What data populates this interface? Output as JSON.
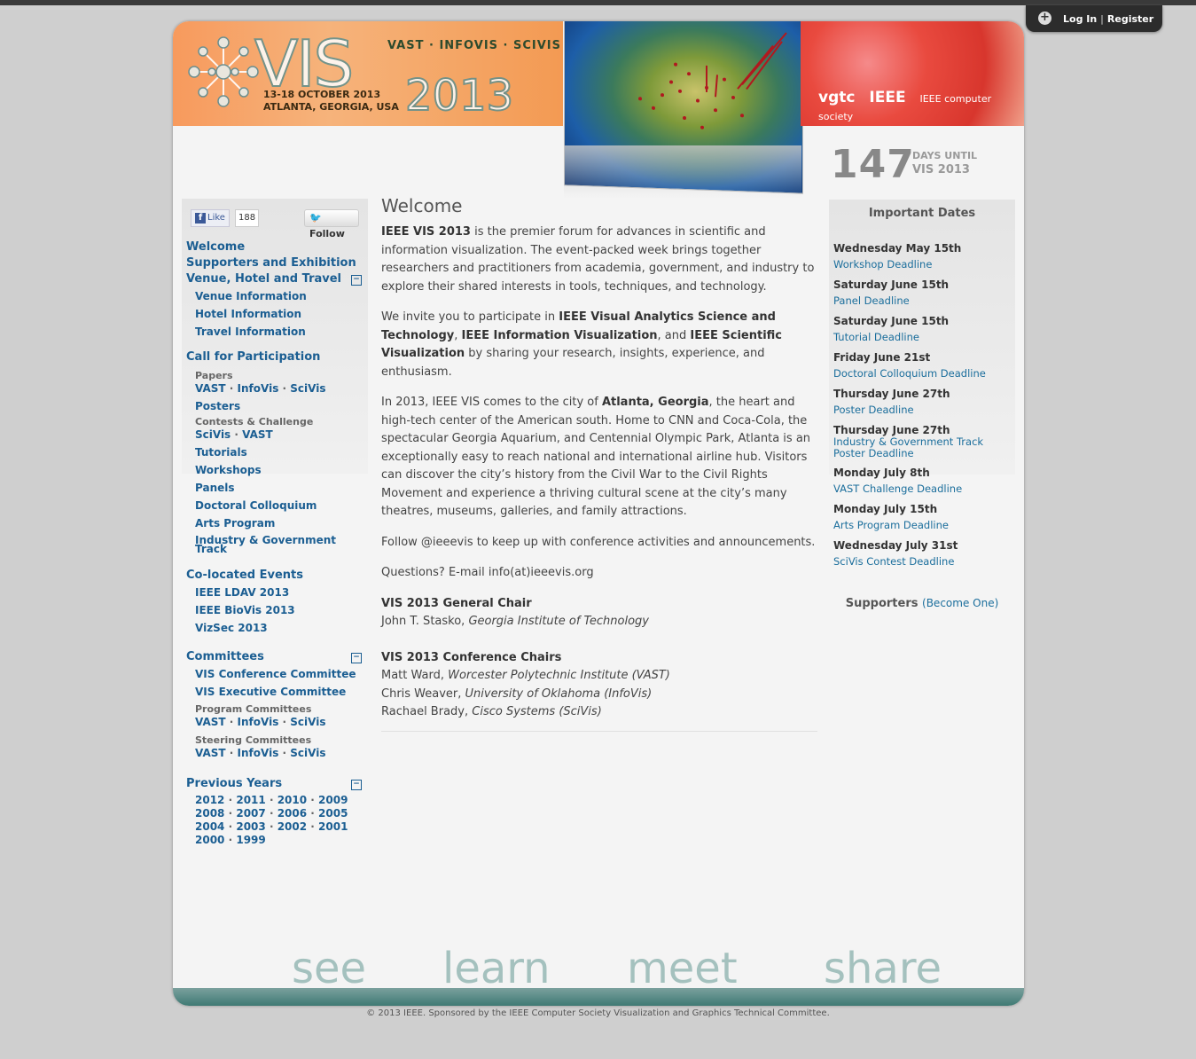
{
  "login": {
    "login_label": "Log In",
    "sep": "|",
    "register_label": "Register"
  },
  "header": {
    "logo_text": "VIS",
    "logo_year": "2013",
    "tracks": "VAST · INFOVIS · SCIVIS",
    "dates_line1": "13-18 OCTOBER 2013",
    "dates_line2": "ATLANTA, GEORGIA, USA",
    "sponsors": [
      "vgtc",
      "IEEE",
      "IEEE computer society"
    ]
  },
  "countdown": {
    "number": "147",
    "label1": "DAYS UNTIL",
    "label2": "VIS 2013"
  },
  "social": {
    "like": "Like",
    "like_count": "188",
    "follow": "Follow"
  },
  "nav": {
    "welcome": "Welcome",
    "supporters": "Supporters and Exhibition",
    "venue": "Venue, Hotel and Travel",
    "venue_items": [
      "Venue Information",
      "Hotel Information",
      "Travel Information"
    ],
    "cfp": "Call for Participation",
    "papers_label": "Papers",
    "papers_links": [
      "VAST",
      "InfoVis",
      "SciVis"
    ],
    "posters": "Posters",
    "contests_label": "Contests & Challenge",
    "contests_links": [
      "SciVis",
      "VAST"
    ],
    "tutorials": "Tutorials",
    "workshops": "Workshops",
    "panels": "Panels",
    "doctoral": "Doctoral Colloquium",
    "arts": "Arts Program",
    "industry": "Industry & Government Track",
    "colocated": "Co-located Events",
    "colocated_items": [
      "IEEE LDAV 2013",
      "IEEE BioVis 2013",
      "VizSec 2013"
    ],
    "committees": "Committees",
    "conf_committee": "VIS Conference Committee",
    "exec_committee": "VIS Executive Committee",
    "program_label": "Program Committees",
    "program_links": [
      "VAST",
      "InfoVis",
      "SciVis"
    ],
    "steering_label": "Steering Committees",
    "steering_links": [
      "VAST",
      "InfoVis",
      "SciVis"
    ],
    "previous": "Previous Years",
    "years": [
      [
        "2012",
        "2011",
        "2010",
        "2009"
      ],
      [
        "2008",
        "2007",
        "2006",
        "2005"
      ],
      [
        "2004",
        "2003",
        "2002",
        "2001"
      ],
      [
        "2000",
        "1999"
      ]
    ],
    "collapse": "−",
    "dot": "·"
  },
  "main": {
    "title": "Welcome",
    "p1_b": "IEEE VIS 2013",
    "p1": " is the premier forum for advances in scientific and information visualization. The event-packed week brings together researchers and practitioners from academia, government, and industry to explore their shared interests in tools, techniques, and technology.",
    "p2_a": "We invite you to participate in ",
    "p2_b1": "IEEE Visual Analytics Science and Technology",
    "p2_c": ", ",
    "p2_b2": "IEEE Information Visualization",
    "p2_d": ", and ",
    "p2_b3": "IEEE Scientific Visualization",
    "p2_e": " by sharing your research, insights, experience, and enthusiasm.",
    "p3_a": "In 2013, IEEE VIS comes to the city of ",
    "p3_b": "Atlanta, Georgia",
    "p3_c": ", the heart and high-tech center of the American south. Home to CNN and Coca-Cola, the spectacular Georgia Aquarium, and Centennial Olympic Park, Atlanta is an exceptionally easy to reach national and international airline hub. Visitors can discover the city’s history from the Civil War to the Civil Rights Movement and experience a thriving cultural scene at the city’s many theatres, museums, galleries, and family attractions.",
    "p4": "Follow @ieeevis to keep up with conference activities and announcements.",
    "p5": "Questions? E-mail info(at)ieeevis.org",
    "general_chair_title": "VIS 2013 General Chair",
    "general_chair_name": "John T. Stasko, ",
    "general_chair_aff": "Georgia Institute of Technology",
    "conf_chairs_title": "VIS 2013 Conference Chairs",
    "chairs": [
      {
        "name": "Matt Ward, ",
        "aff": "Worcester Polytechnic Institute (VAST)"
      },
      {
        "name": "Chris Weaver, ",
        "aff": "University of Oklahoma (InfoVis)"
      },
      {
        "name": "Rachael Brady, ",
        "aff": "Cisco Systems (SciVis)"
      }
    ]
  },
  "important_dates": {
    "title": "Important Dates",
    "items": [
      {
        "date": "Wednesday May 15th",
        "event": "Workshop Deadline"
      },
      {
        "date": "Saturday June 15th",
        "event": "Panel Deadline"
      },
      {
        "date": "Saturday June 15th",
        "event": "Tutorial Deadline"
      },
      {
        "date": "Friday June 21st",
        "event": "Doctoral Colloquium Deadline"
      },
      {
        "date": "Thursday June 27th",
        "event": "Poster Deadline"
      },
      {
        "date": "Thursday June 27th",
        "event": "Industry & Government Track Poster Deadline"
      },
      {
        "date": "Monday July 8th",
        "event": "VAST Challenge Deadline"
      },
      {
        "date": "Monday July 15th",
        "event": "Arts Program Deadline"
      },
      {
        "date": "Wednesday July 31st",
        "event": "SciVis Contest Deadline"
      }
    ]
  },
  "supporters": {
    "title": "Supporters",
    "become": "(Become One)"
  },
  "footer": {
    "words": [
      "see",
      "learn",
      "meet",
      "share"
    ],
    "copyright": "© 2013 IEEE. Sponsored by the IEEE Computer Society Visualization and Graphics Technical Committee."
  },
  "colors": {
    "link": "#1b5e92",
    "accent": "#f39a53",
    "band": "#3f7a74"
  }
}
